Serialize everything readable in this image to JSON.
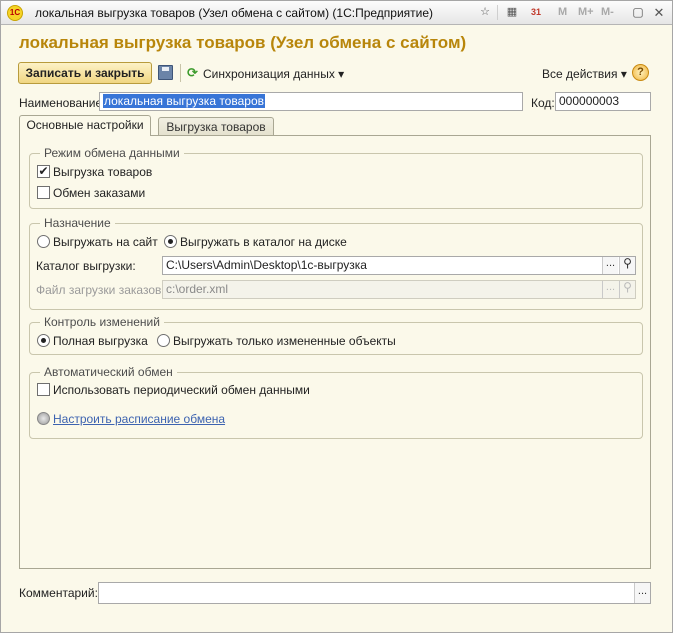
{
  "window": {
    "title": "локальная выгрузка товаров (Узел обмена с сайтом)  (1С:Предприятие)",
    "logo_text": "1C",
    "mem_buttons": [
      "M",
      "M+",
      "M-"
    ],
    "calendar_day": "31"
  },
  "form": {
    "title": "локальная выгрузка товаров (Узел обмена с сайтом)"
  },
  "toolbar": {
    "save_close_label": "Записать и закрыть",
    "sync_label": "Синхронизация данных",
    "all_actions_label": "Все действия",
    "help_label": "?"
  },
  "fields": {
    "name_label": "Наименование:",
    "name_value": "локальная выгрузка товаров",
    "code_label": "Код:",
    "code_value": "000000003",
    "comment_label": "Комментарий:",
    "comment_value": ""
  },
  "tabs": [
    {
      "label": "Основные настройки",
      "active": true
    },
    {
      "label": "Выгрузка товаров",
      "active": false
    }
  ],
  "exchange_mode": {
    "title": "Режим обмена данными",
    "goods_export_label": "Выгрузка товаров",
    "goods_export_checked": true,
    "orders_exchange_label": "Обмен заказами",
    "orders_exchange_checked": false
  },
  "destination": {
    "title": "Назначение",
    "to_site_label": "Выгружать на сайт",
    "to_disk_label": "Выгружать в каталог на диске",
    "selected": "disk",
    "export_dir_label": "Каталог выгрузки:",
    "export_dir_value": "C:\\Users\\Admin\\Desktop\\1с-выгрузка",
    "orders_file_label": "Файл загрузки заказов:",
    "orders_file_value": "c:\\order.xml"
  },
  "change_control": {
    "title": "Контроль изменений",
    "full_label": "Полная выгрузка",
    "changed_only_label": "Выгружать только измененные объекты",
    "selected": "full"
  },
  "auto_exchange": {
    "title": "Автоматический обмен",
    "periodic_label": "Использовать периодический обмен данными",
    "periodic_checked": false,
    "schedule_link": "Настроить расписание обмена"
  },
  "glyphs": {
    "ellipsis": "...",
    "magnifier": "⚲",
    "dropdown": "▾",
    "check": "✔",
    "sync": "⟳"
  },
  "colors": {
    "form_title": "#b8860b",
    "background": "#fbf9ea",
    "primary_button": "#f0d682",
    "selection": "#3875d7",
    "link": "#3d63b0"
  }
}
